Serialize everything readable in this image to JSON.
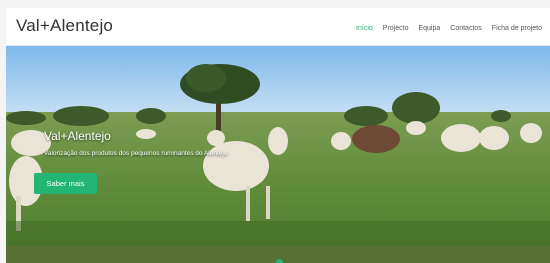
{
  "brand": "Val+Alentejo",
  "nav": {
    "items": [
      "Início",
      "Projecto",
      "Equipa",
      "Contactos",
      "Ficha de projeto"
    ],
    "active_index": 0
  },
  "hero": {
    "title": "Val+Alentejo",
    "subtitle": "Valorização dos produtos dos pequenos ruminantes do Alentejo",
    "cta_label": "Saber mais"
  },
  "colors": {
    "accent": "#22b574",
    "sky": "#8fc3ec",
    "grass": "#5f8b3a"
  }
}
